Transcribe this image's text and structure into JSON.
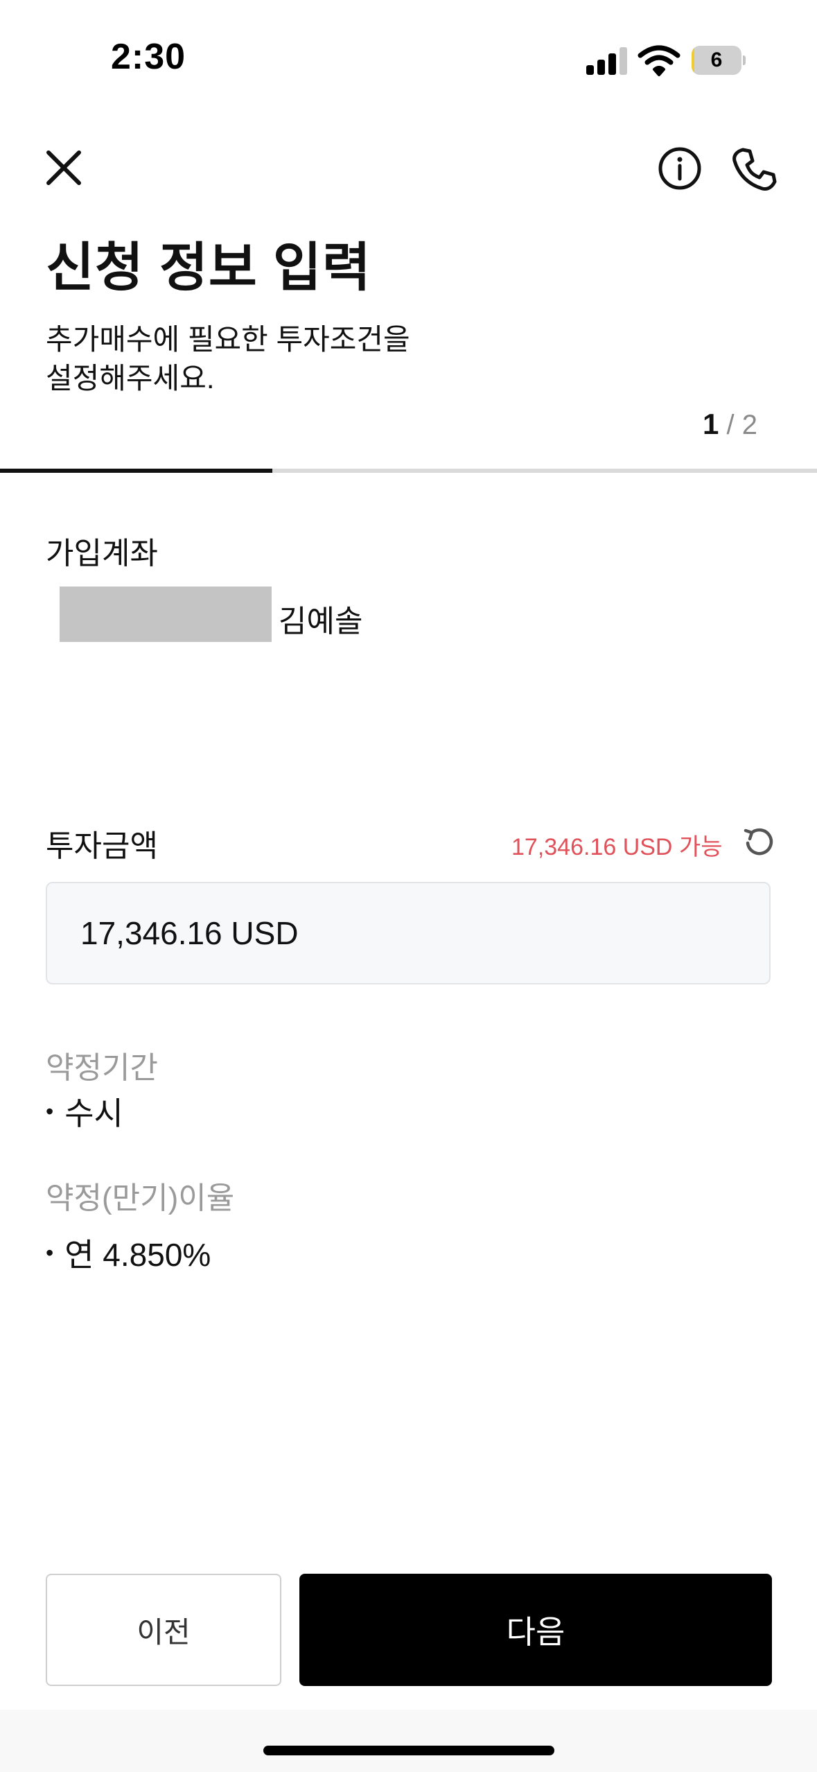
{
  "status_bar": {
    "time": "2:30",
    "battery_percent": "6",
    "battery_level": 0.06,
    "signal_bars": 3,
    "signal_bars_max": 4
  },
  "header": {
    "close_icon": "close-icon",
    "info_icon": "info-icon",
    "phone_icon": "phone-icon",
    "title": "신청 정보 입력",
    "description_line1": "추가매수에 필요한 투자조건을",
    "description_line2": "설정해주세요.",
    "step_current": "1",
    "step_separator": " / ",
    "step_total": "2",
    "progress_fraction": 0.333
  },
  "account": {
    "label": "가입계좌",
    "holder_name": "김예솔"
  },
  "amount": {
    "label": "투자금액",
    "available_text": "17,346.16 USD 가능",
    "input_value": "17,346.16 USD",
    "refresh_icon": "refresh-icon"
  },
  "terms": {
    "term_label": "약정기간",
    "term_value": "수시",
    "rate_label": "약정(만기)이율",
    "rate_value": "연 4.850%"
  },
  "buttons": {
    "prev_label": "이전",
    "next_label": "다음"
  },
  "colors": {
    "accent_red": "#e0515a",
    "primary_button": "#000000",
    "battery_fill": "#f2cc2f"
  }
}
